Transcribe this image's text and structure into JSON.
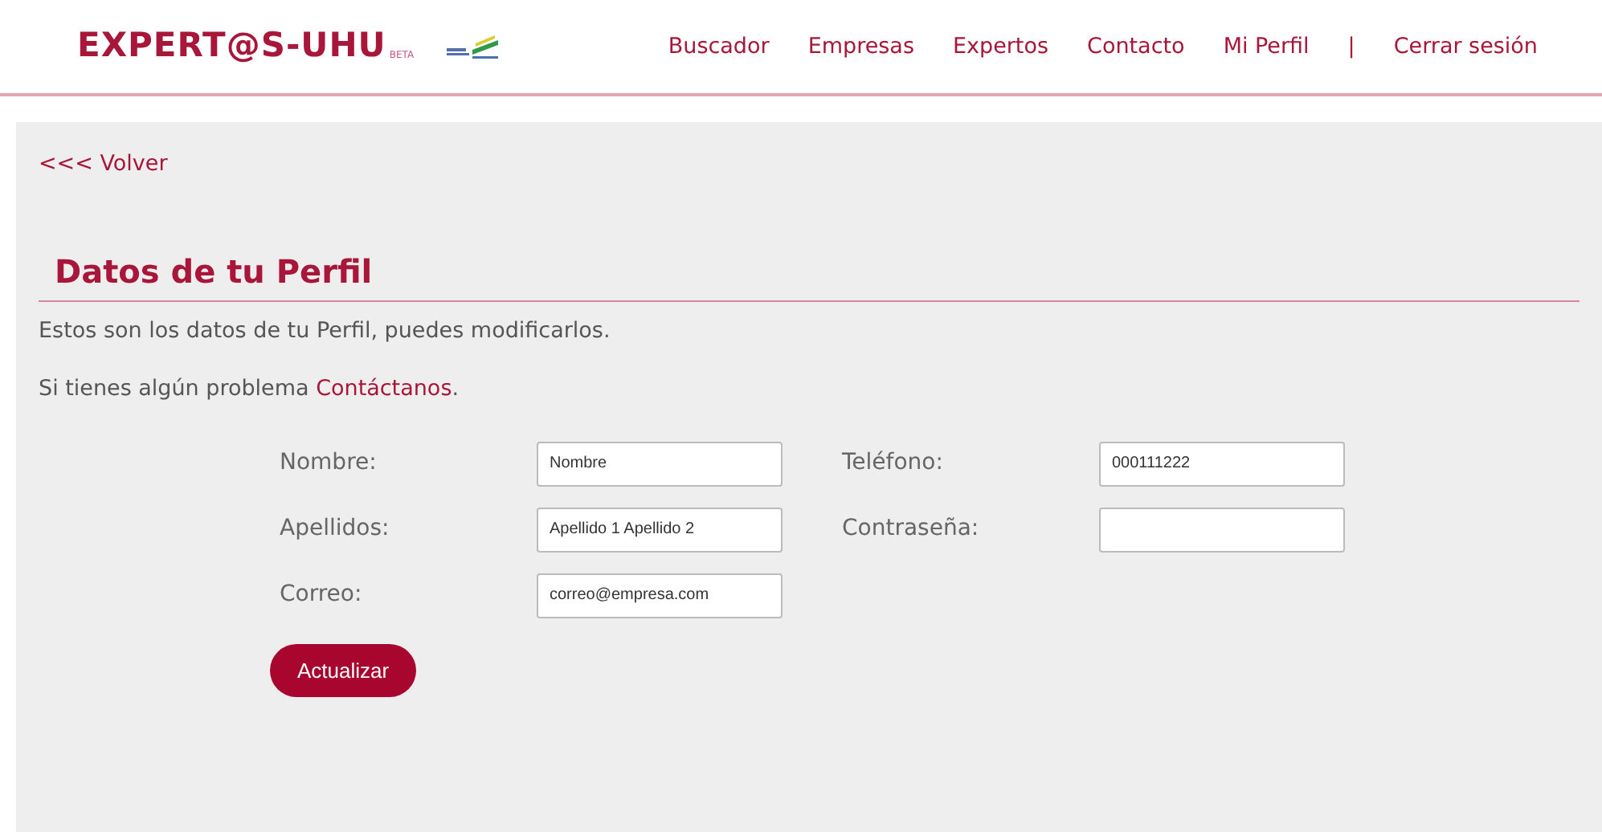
{
  "header": {
    "logo": "EXPERT@S-UHU",
    "logo_badge": "BETA",
    "nav": [
      {
        "label": "Buscador"
      },
      {
        "label": "Empresas"
      },
      {
        "label": "Expertos"
      },
      {
        "label": "Contacto"
      },
      {
        "label": "Mi Perfil",
        "separator_after": "|"
      },
      {
        "label": "Cerrar sesión"
      }
    ]
  },
  "back_link": "<<< Volver",
  "title": "Datos de tu Perfil",
  "intro": "Estos son los datos de tu Perfil, puedes modificarlos.",
  "help": {
    "text": "Si tienes algún problema ",
    "link": "Contáctanos",
    "after": "."
  },
  "form": {
    "columns": [
      [
        {
          "label": "Nombre:",
          "value": "Nombre"
        },
        {
          "label": "Apellidos:",
          "value": "Apellido 1 Apellido 2"
        },
        {
          "label": "Correo:",
          "value": "correo@empresa.com"
        }
      ],
      [
        {
          "label": "Teléfono:",
          "value": "000111222"
        },
        {
          "label": "Contraseña:"
        }
      ]
    ]
  },
  "submit": "Actualizar"
}
